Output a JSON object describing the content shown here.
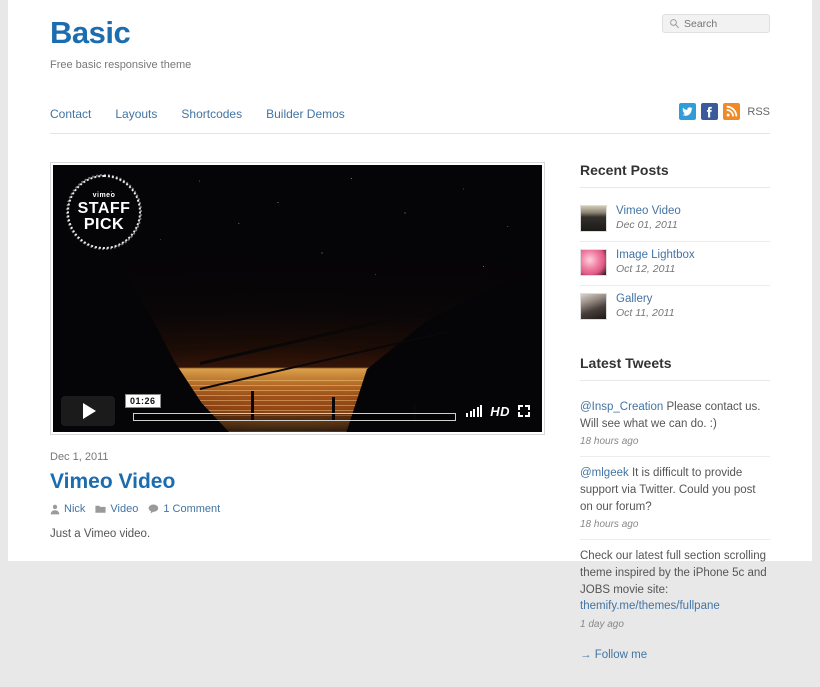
{
  "header": {
    "site_title": "Basic",
    "site_description": "Free basic responsive theme"
  },
  "search": {
    "placeholder": "Search",
    "value": "",
    "icon": "search-icon"
  },
  "nav": {
    "items": [
      {
        "label": "Contact"
      },
      {
        "label": "Layouts"
      },
      {
        "label": "Shortcodes"
      },
      {
        "label": "Builder Demos"
      }
    ]
  },
  "social": {
    "twitter_icon": "twitter-icon",
    "facebook_icon": "facebook-icon",
    "rss_icon": "rss-icon",
    "rss_label": "RSS",
    "twitter_color": "#2f9ed8",
    "facebook_color": "#3a5a9b",
    "rss_color": "#f08a24"
  },
  "video": {
    "badge_brand": "vimeo",
    "badge_line1": "STAFF",
    "badge_line2": "PICK",
    "time_tooltip": "01:26",
    "play_icon": "play-icon",
    "volume_icon": "volume-icon",
    "hd_label": "HD",
    "fullscreen_icon": "fullscreen-icon"
  },
  "post": {
    "date": "Dec 1, 2011",
    "title": "Vimeo Video",
    "author": "Nick",
    "category": "Video",
    "comments": "1 Comment",
    "author_icon": "user-icon",
    "category_icon": "folder-icon",
    "comments_icon": "comment-icon",
    "excerpt": "Just a Vimeo video."
  },
  "sidebar": {
    "recent_posts": {
      "title": "Recent Posts",
      "items": [
        {
          "title": "Vimeo Video",
          "date": "Dec 01, 2011"
        },
        {
          "title": "Image Lightbox",
          "date": "Oct 12, 2011"
        },
        {
          "title": "Gallery",
          "date": "Oct 11, 2011"
        }
      ]
    },
    "latest_tweets": {
      "title": "Latest Tweets",
      "items": [
        {
          "mention": "@Insp_Creation",
          "text": " Please contact us. Will see what we can do. :)",
          "link": "",
          "time": "18 hours ago"
        },
        {
          "mention": "@mlgeek",
          "text": " It is difficult to provide support via Twitter. Could you post on our forum?",
          "link": "",
          "time": "18 hours ago"
        },
        {
          "mention": "",
          "text": "Check our latest full section scrolling theme inspired by the iPhone 5c and JOBS movie site: ",
          "link": "themify.me/themes/fullpane",
          "time": "1 day ago"
        }
      ],
      "follow_label": "→ Follow me"
    }
  }
}
